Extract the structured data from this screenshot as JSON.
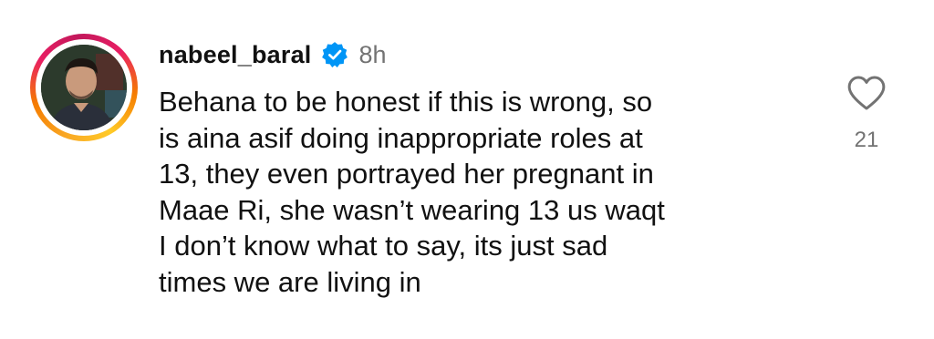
{
  "comment": {
    "username": "nabeel_baral",
    "verified": true,
    "timestamp": "8h",
    "text": "Behana to be honest if this is wrong, so\nis aina asif doing inappropriate roles at\n13, they even portrayed her pregnant in\nMaae Ri, she wasn’t wearing 13 us waqt\nI don’t know what to say, its just sad\ntimes we are living in",
    "like_count": "21"
  },
  "icons": {
    "verified": "verified-badge-icon",
    "like": "heart-outline-icon"
  },
  "colors": {
    "text": "#111111",
    "secondary_text": "#737373",
    "verified_badge": "#0095f6",
    "story_ring_start": "#f9a825",
    "story_ring_end": "#e91e63"
  }
}
